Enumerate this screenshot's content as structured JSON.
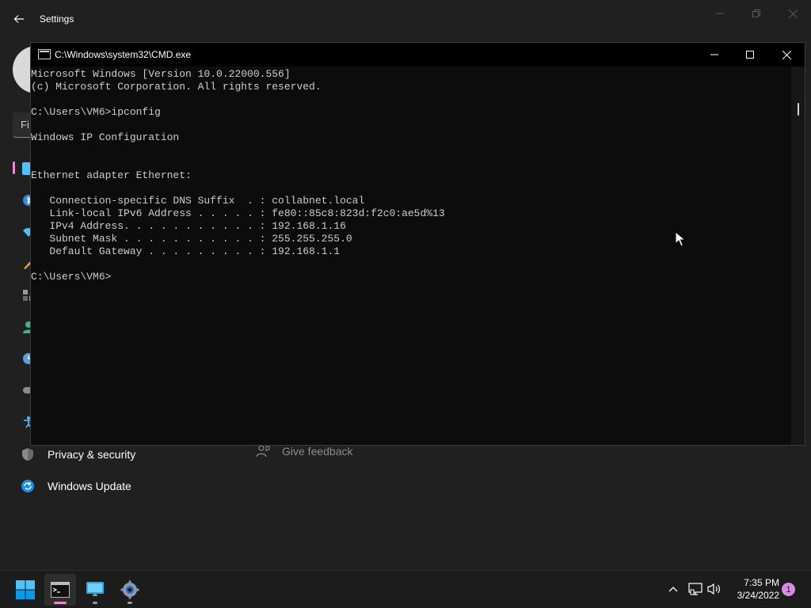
{
  "settings": {
    "title": "Settings",
    "search_placeholder": "Fi",
    "nav": [
      {
        "label": "Privacy & security",
        "icon": "shield-icon"
      },
      {
        "label": "Windows Update",
        "icon": "windows-update-icon"
      }
    ],
    "feedback_label": "Give feedback"
  },
  "cmd": {
    "title": "C:\\Windows\\system32\\CMD.exe",
    "lines": [
      "Microsoft Windows [Version 10.0.22000.556]",
      "(c) Microsoft Corporation. All rights reserved.",
      "",
      "C:\\Users\\VM6>ipconfig",
      "",
      "Windows IP Configuration",
      "",
      "",
      "Ethernet adapter Ethernet:",
      "",
      "   Connection-specific DNS Suffix  . : collabnet.local",
      "   Link-local IPv6 Address . . . . . : fe80::85c8:823d:f2c0:ae5d%13",
      "   IPv4 Address. . . . . . . . . . . : 192.168.1.16",
      "   Subnet Mask . . . . . . . . . . . : 255.255.255.0",
      "   Default Gateway . . . . . . . . . : 192.168.1.1",
      "",
      "C:\\Users\\VM6>"
    ]
  },
  "taskbar": {
    "apps": [
      {
        "name": "start-button",
        "icon": "windows-logo-icon"
      },
      {
        "name": "cmd-app",
        "icon": "terminal-icon"
      },
      {
        "name": "remote-desktop-app",
        "icon": "monitor-icon"
      },
      {
        "name": "settings-app",
        "icon": "gear-icon"
      }
    ],
    "time": "7:35 PM",
    "date": "3/24/2022",
    "notification_count": "1"
  },
  "colors": {
    "accent": "#e68cd0",
    "terminal_bg": "#0c0c0c",
    "terminal_text": "#cccccc",
    "windows_blue": "#0078d4"
  }
}
